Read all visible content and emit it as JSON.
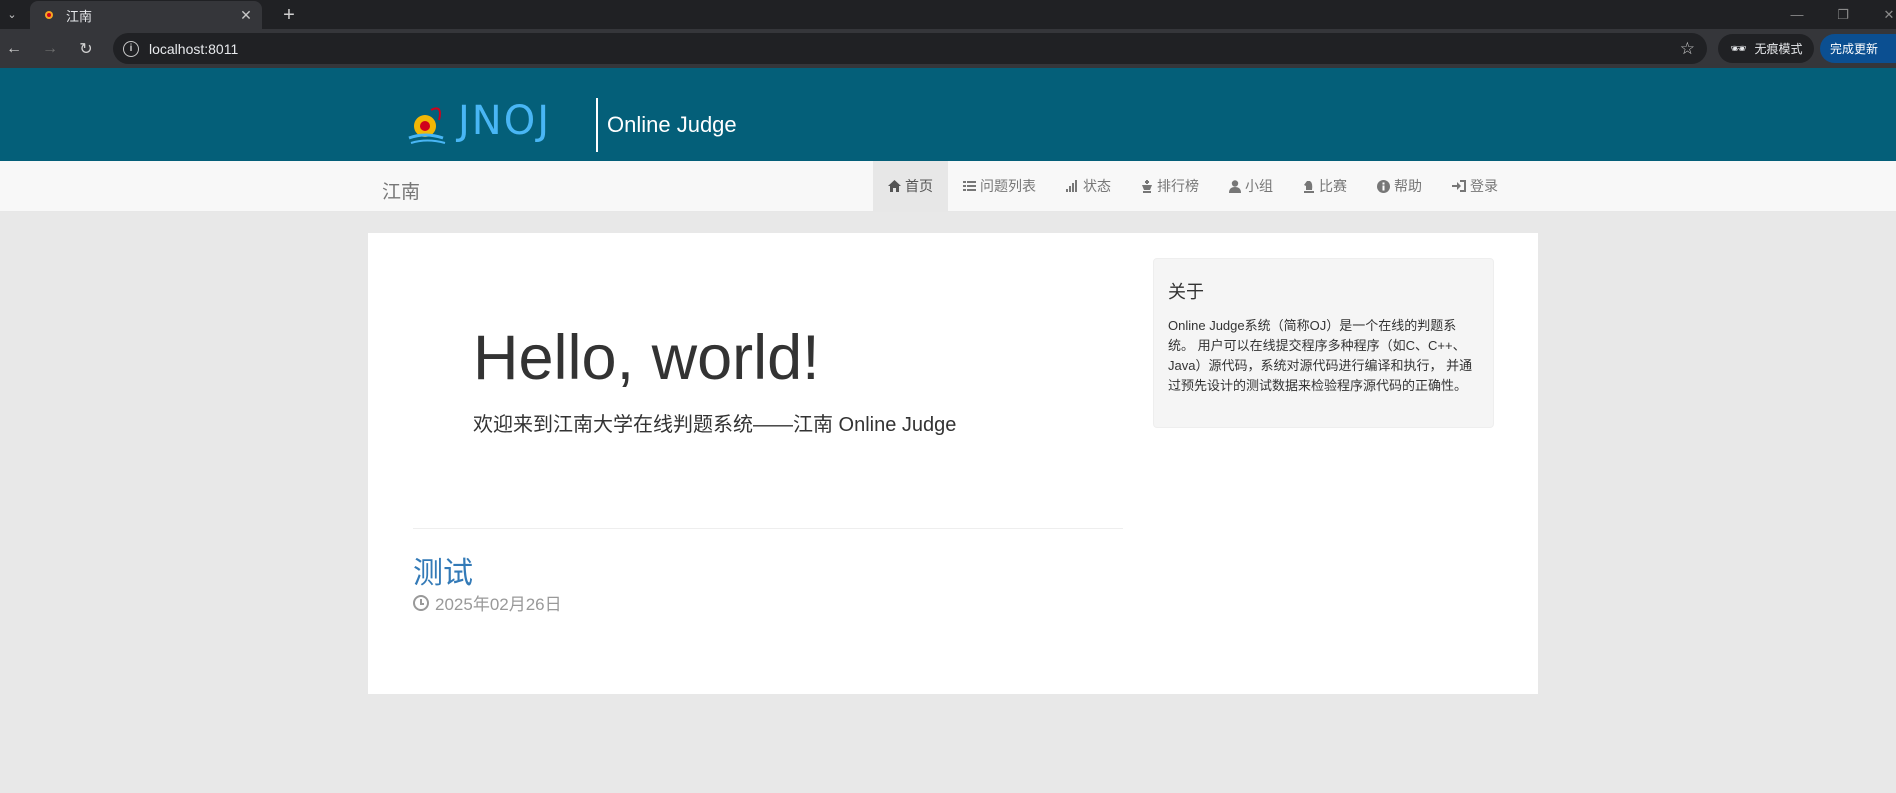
{
  "browser": {
    "tab_title": "江南",
    "url": "localhost:8011",
    "incognito_label": "无痕模式",
    "update_label": "完成更新"
  },
  "header": {
    "logo_text": "JNOJ",
    "title": "Online Judge"
  },
  "navbar": {
    "brand": "江南",
    "items": [
      {
        "label": "首页",
        "icon": "home-icon",
        "active": true
      },
      {
        "label": "问题列表",
        "icon": "list-icon",
        "active": false
      },
      {
        "label": "状态",
        "icon": "signal-icon",
        "active": false
      },
      {
        "label": "排行榜",
        "icon": "king-icon",
        "active": false
      },
      {
        "label": "小组",
        "icon": "user-icon",
        "active": false
      },
      {
        "label": "比赛",
        "icon": "knight-icon",
        "active": false
      },
      {
        "label": "帮助",
        "icon": "info-icon",
        "active": false
      },
      {
        "label": "登录",
        "icon": "log-in-icon",
        "active": false
      }
    ]
  },
  "jumbotron": {
    "heading": "Hello, world!",
    "subtitle": "欢迎来到江南大学在线判题系统——江南 Online Judge"
  },
  "news": [
    {
      "title": "测试",
      "date": "2025年02月26日"
    }
  ],
  "about": {
    "title": "关于",
    "text": "Online Judge系统（简称OJ）是一个在线的判题系统。 用户可以在线提交程序多种程序（如C、C++、Java）源代码，系统对源代码进行编译和执行， 并通过预先设计的测试数据来检验程序源代码的正确性。"
  },
  "colors": {
    "header_bg": "#045f79",
    "navbar_bg": "#f8f8f8",
    "link": "#337ab7",
    "page_bg": "#e8e8e8"
  }
}
